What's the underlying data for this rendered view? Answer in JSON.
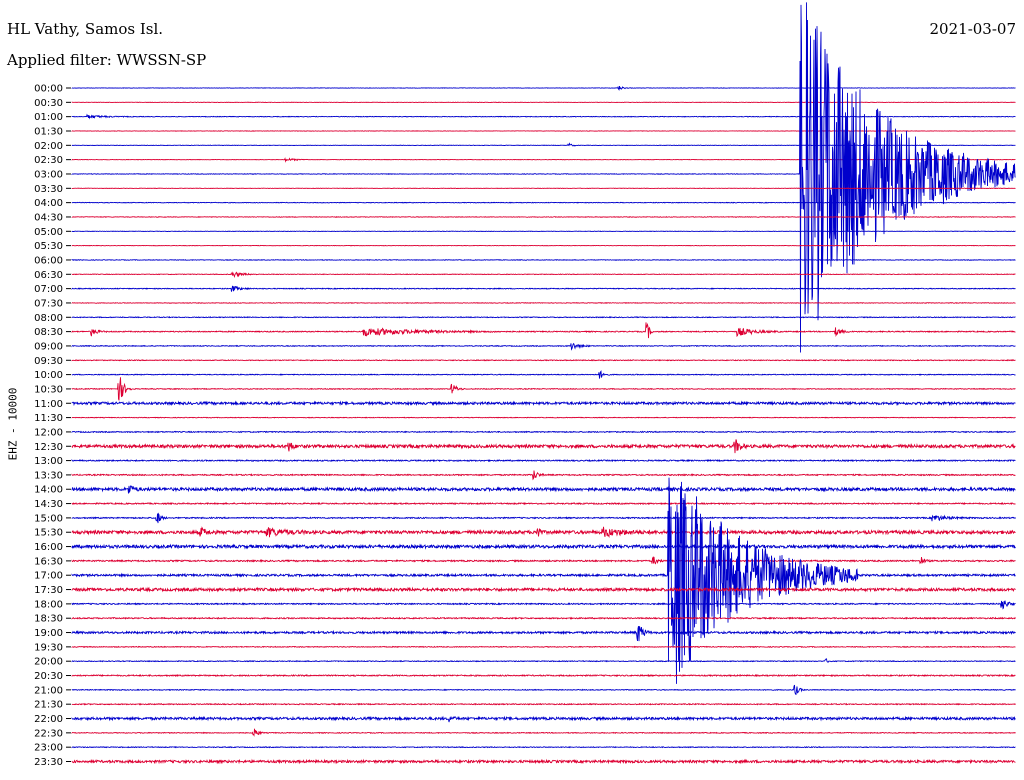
{
  "header": {
    "station": "HL Vathy, Samos Isl.",
    "filter": "Applied filter: WWSSN-SP",
    "date": "2021-03-07"
  },
  "colors": {
    "even_hour": "#0000cc",
    "half_hour": "#dd0033"
  },
  "chart_data": {
    "type": "helicorder",
    "ylabel": "EHZ - 10000",
    "line_labels": [
      "00:00",
      "00:30",
      "01:00",
      "01:30",
      "02:00",
      "02:30",
      "03:00",
      "03:30",
      "04:00",
      "04:30",
      "05:00",
      "05:30",
      "06:00",
      "06:30",
      "07:00",
      "07:30",
      "08:00",
      "08:30",
      "09:00",
      "09:30",
      "10:00",
      "10:30",
      "11:00",
      "11:30",
      "12:00",
      "12:30",
      "13:00",
      "13:30",
      "14:00",
      "14:30",
      "15:00",
      "15:30",
      "16:00",
      "16:30",
      "17:00",
      "17:30",
      "18:00",
      "18:30",
      "19:00",
      "19:30",
      "20:00",
      "20:30",
      "21:00",
      "21:30",
      "22:00",
      "22:30",
      "23:00",
      "23:30"
    ],
    "minutes_per_line": 30,
    "noise_levels": [
      0.2,
      0.2,
      0.3,
      0.2,
      0.2,
      0.2,
      0.3,
      0.2,
      0.3,
      0.3,
      0.2,
      0.2,
      0.3,
      0.3,
      0.4,
      0.3,
      0.4,
      0.5,
      0.4,
      0.4,
      0.4,
      0.4,
      1.2,
      0.3,
      0.5,
      1.5,
      0.6,
      0.6,
      1.5,
      0.6,
      0.6,
      1.6,
      1.5,
      0.7,
      1.0,
      1.4,
      0.6,
      0.6,
      1.0,
      0.4,
      0.4,
      0.6,
      0.4,
      0.5,
      1.2,
      0.4,
      0.4,
      1.2
    ],
    "events": [
      {
        "line": 0,
        "minute": 17.4,
        "amplitude": 2,
        "duration_min": 0.4
      },
      {
        "line": 2,
        "minute": 0.5,
        "amplitude": 1.5,
        "duration_min": 1.5
      },
      {
        "line": 4,
        "minute": 15.8,
        "amplitude": 2,
        "duration_min": 0.3
      },
      {
        "line": 5,
        "minute": 6.8,
        "amplitude": 1.5,
        "duration_min": 0.8
      },
      {
        "line": 6,
        "minute": 27.6,
        "amplitude": 4,
        "duration_min": 0.8
      },
      {
        "line": 6,
        "minute": 23.2,
        "amplitude": 188,
        "duration_min": 7.0
      },
      {
        "line": 13,
        "minute": 5.1,
        "amplitude": 3,
        "duration_min": 0.8
      },
      {
        "line": 14,
        "minute": 5.1,
        "amplitude": 3,
        "duration_min": 0.6
      },
      {
        "line": 17,
        "minute": 0.6,
        "amplitude": 4,
        "duration_min": 0.5
      },
      {
        "line": 17,
        "minute": 9.3,
        "amplitude": 4,
        "duration_min": 4.5
      },
      {
        "line": 17,
        "minute": 18.3,
        "amplitude": 9,
        "duration_min": 0.2
      },
      {
        "line": 17,
        "minute": 21.2,
        "amplitude": 4,
        "duration_min": 1.4
      },
      {
        "line": 17,
        "minute": 24.3,
        "amplitude": 4,
        "duration_min": 0.5
      },
      {
        "line": 18,
        "minute": 15.9,
        "amplitude": 4,
        "duration_min": 0.6
      },
      {
        "line": 20,
        "minute": 16.8,
        "amplitude": 4,
        "duration_min": 0.3
      },
      {
        "line": 21,
        "minute": 1.5,
        "amplitude": 14,
        "duration_min": 0.4
      },
      {
        "line": 21,
        "minute": 12.1,
        "amplitude": 5,
        "duration_min": 0.4
      },
      {
        "line": 25,
        "minute": 6.9,
        "amplitude": 5,
        "duration_min": 0.3
      },
      {
        "line": 25,
        "minute": 21.1,
        "amplitude": 7,
        "duration_min": 0.4
      },
      {
        "line": 27,
        "minute": 14.7,
        "amplitude": 5,
        "duration_min": 0.3
      },
      {
        "line": 28,
        "minute": 1.8,
        "amplitude": 5,
        "duration_min": 0.4
      },
      {
        "line": 30,
        "minute": 2.7,
        "amplitude": 7,
        "duration_min": 0.3
      },
      {
        "line": 30,
        "minute": 27.4,
        "amplitude": 3,
        "duration_min": 1.2
      },
      {
        "line": 31,
        "minute": 4.1,
        "amplitude": 4,
        "duration_min": 0.5
      },
      {
        "line": 31,
        "minute": 6.2,
        "amplitude": 4,
        "duration_min": 1.4
      },
      {
        "line": 31,
        "minute": 14.8,
        "amplitude": 9,
        "duration_min": 0.2
      },
      {
        "line": 31,
        "minute": 16.9,
        "amplitude": 4,
        "duration_min": 1.5
      },
      {
        "line": 33,
        "minute": 18.5,
        "amplitude": 4,
        "duration_min": 0.3
      },
      {
        "line": 33,
        "minute": 27.0,
        "amplitude": 4,
        "duration_min": 0.3
      },
      {
        "line": 34,
        "minute": 19.0,
        "amplitude": 120,
        "duration_min": 6.0
      },
      {
        "line": 36,
        "minute": 29.6,
        "amplitude": 6,
        "duration_min": 0.4
      },
      {
        "line": 38,
        "minute": 18.0,
        "amplitude": 11,
        "duration_min": 0.4
      },
      {
        "line": 40,
        "minute": 24.0,
        "amplitude": 2,
        "duration_min": 0.2
      },
      {
        "line": 42,
        "minute": 23.0,
        "amplitude": 6,
        "duration_min": 0.3
      },
      {
        "line": 44,
        "minute": 12.0,
        "amplitude": 3,
        "duration_min": 0.3
      },
      {
        "line": 45,
        "minute": 5.8,
        "amplitude": 5,
        "duration_min": 0.3
      }
    ]
  }
}
